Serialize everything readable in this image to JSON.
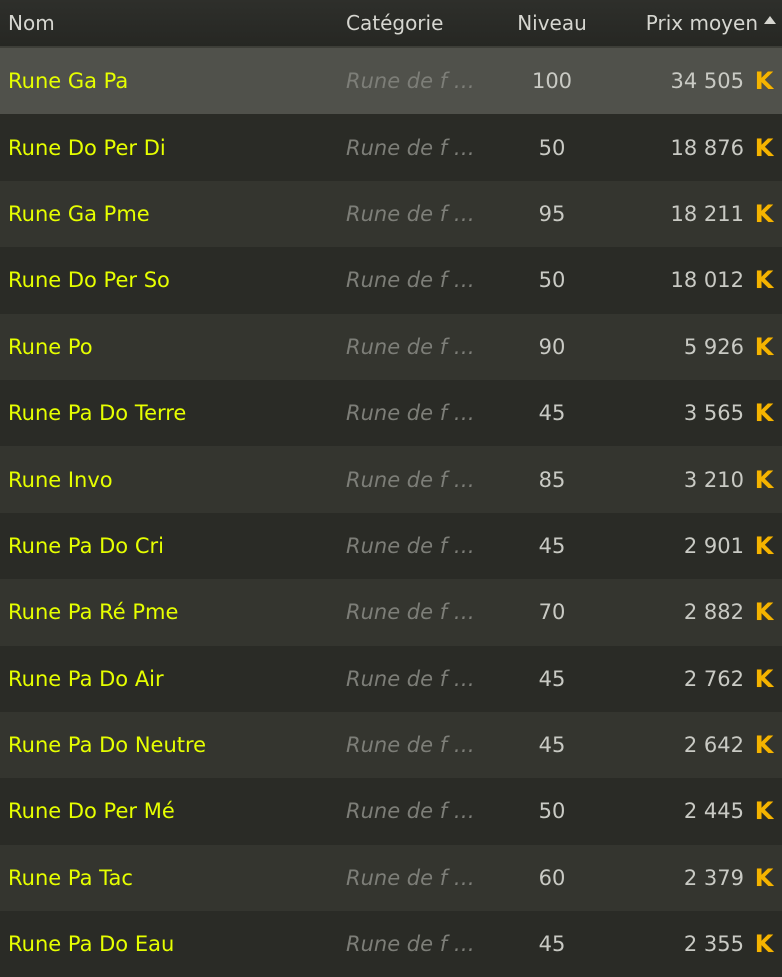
{
  "header": {
    "name": "Nom",
    "category": "Catégorie",
    "level": "Niveau",
    "price": "Prix moyen"
  },
  "rows": [
    {
      "name": "Rune Ga Pa",
      "category": "Rune de f …",
      "level": "100",
      "price": "34 505"
    },
    {
      "name": "Rune Do Per Di",
      "category": "Rune de f …",
      "level": "50",
      "price": "18 876"
    },
    {
      "name": "Rune Ga Pme",
      "category": "Rune de f …",
      "level": "95",
      "price": "18 211"
    },
    {
      "name": "Rune Do Per So",
      "category": "Rune de f …",
      "level": "50",
      "price": "18 012"
    },
    {
      "name": "Rune Po",
      "category": "Rune de f …",
      "level": "90",
      "price": "5 926"
    },
    {
      "name": "Rune Pa Do Terre",
      "category": "Rune de f …",
      "level": "45",
      "price": "3 565"
    },
    {
      "name": "Rune Invo",
      "category": "Rune de f …",
      "level": "85",
      "price": "3 210"
    },
    {
      "name": "Rune Pa Do Cri",
      "category": "Rune de f …",
      "level": "45",
      "price": "2 901"
    },
    {
      "name": "Rune Pa Ré Pme",
      "category": "Rune de f …",
      "level": "70",
      "price": "2 882"
    },
    {
      "name": "Rune Pa Do Air",
      "category": "Rune de f …",
      "level": "45",
      "price": "2 762"
    },
    {
      "name": "Rune Pa Do Neutre",
      "category": "Rune de f …",
      "level": "45",
      "price": "2 642"
    },
    {
      "name": "Rune Do Per Mé",
      "category": "Rune de f …",
      "level": "50",
      "price": "2 445"
    },
    {
      "name": "Rune Pa Tac",
      "category": "Rune de f …",
      "level": "60",
      "price": "2 379"
    },
    {
      "name": "Rune Pa Do Eau",
      "category": "Rune de f …",
      "level": "45",
      "price": "2 355"
    }
  ],
  "kama_glyph": "K",
  "colors": {
    "item_name": "#e6ff00",
    "kama_icon": "#f5b400"
  }
}
